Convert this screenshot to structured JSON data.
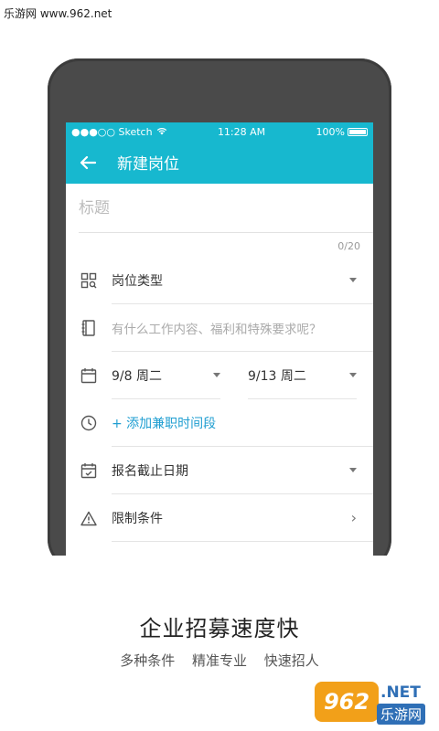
{
  "watermark": "乐游网 www.962.net",
  "status": {
    "carrier": "●●●○○ Sketch",
    "time": "11:28 AM",
    "battery": "100%"
  },
  "appbar": {
    "back_icon": "arrow-left-icon",
    "title": "新建岗位"
  },
  "form": {
    "title_placeholder": "标题",
    "title_counter": "0/20",
    "job_type": "岗位类型",
    "content_placeholder": "有什么工作内容、福利和特殊要求呢？",
    "start_date": "9/8 周二",
    "end_date": "9/13 周二",
    "add_time": "+ 添加兼职时间段",
    "deadline": "报名截止日期",
    "restrictions": "限制条件"
  },
  "promo": {
    "slogan": "企业招募速度快",
    "subtitle": "多种条件 精准专业 快速招人"
  },
  "logo": {
    "badge": "962",
    "net": ".NET",
    "cn": "乐游网"
  },
  "colors": {
    "accent": "#17b8cf",
    "link": "#1f9ed1",
    "phone": "#4a4a4a"
  }
}
